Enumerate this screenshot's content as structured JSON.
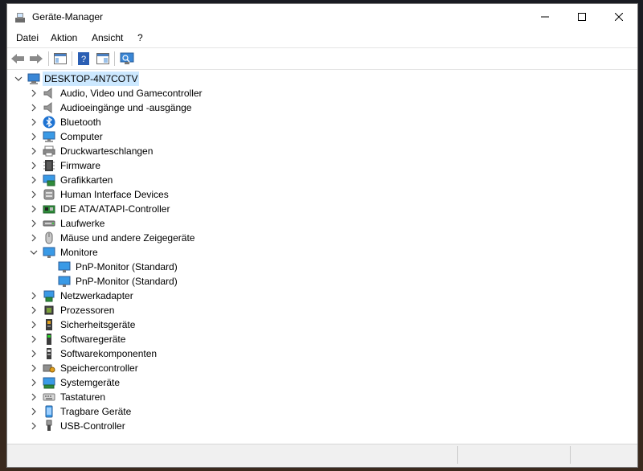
{
  "window": {
    "title": "Geräte-Manager"
  },
  "menu": [
    "Datei",
    "Aktion",
    "Ansicht",
    "?"
  ],
  "tree": {
    "root": "DESKTOP-4N7COTV",
    "categories": [
      {
        "label": "Audio, Video und Gamecontroller",
        "icon": "speaker-icon"
      },
      {
        "label": "Audioeingänge und -ausgänge",
        "icon": "speaker-icon"
      },
      {
        "label": "Bluetooth",
        "icon": "bluetooth-icon"
      },
      {
        "label": "Computer",
        "icon": "computer-icon"
      },
      {
        "label": "Druckwarteschlangen",
        "icon": "printer-icon"
      },
      {
        "label": "Firmware",
        "icon": "firmware-icon"
      },
      {
        "label": "Grafikkarten",
        "icon": "display-adapter-icon"
      },
      {
        "label": "Human Interface Devices",
        "icon": "hid-icon"
      },
      {
        "label": "IDE ATA/ATAPI-Controller",
        "icon": "ide-controller-icon"
      },
      {
        "label": "Laufwerke",
        "icon": "disk-drive-icon"
      },
      {
        "label": "Mäuse und andere Zeigegeräte",
        "icon": "mouse-icon"
      },
      {
        "label": "Monitore",
        "icon": "monitor-icon",
        "expanded": true,
        "children": [
          "PnP-Monitor (Standard)",
          "PnP-Monitor (Standard)"
        ]
      },
      {
        "label": "Netzwerkadapter",
        "icon": "network-adapter-icon"
      },
      {
        "label": "Prozessoren",
        "icon": "processor-icon"
      },
      {
        "label": "Sicherheitsgeräte",
        "icon": "security-device-icon"
      },
      {
        "label": "Softwaregeräte",
        "icon": "software-device-icon"
      },
      {
        "label": "Softwarekomponenten",
        "icon": "software-component-icon"
      },
      {
        "label": "Speichercontroller",
        "icon": "storage-controller-icon"
      },
      {
        "label": "Systemgeräte",
        "icon": "system-device-icon"
      },
      {
        "label": "Tastaturen",
        "icon": "keyboard-icon"
      },
      {
        "label": "Tragbare Geräte",
        "icon": "portable-device-icon"
      },
      {
        "label": "USB-Controller",
        "icon": "usb-icon"
      }
    ]
  }
}
